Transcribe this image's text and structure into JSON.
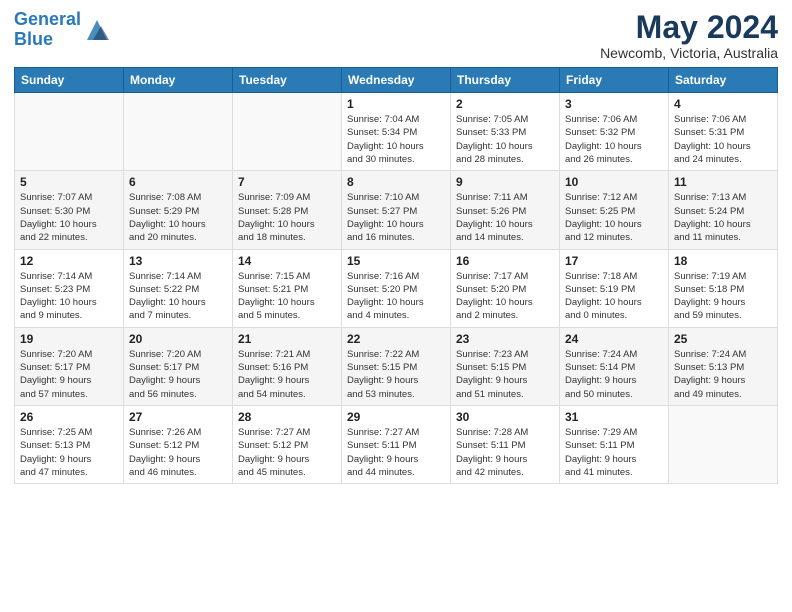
{
  "header": {
    "logo_line1": "General",
    "logo_line2": "Blue",
    "month_year": "May 2024",
    "location": "Newcomb, Victoria, Australia"
  },
  "weekdays": [
    "Sunday",
    "Monday",
    "Tuesday",
    "Wednesday",
    "Thursday",
    "Friday",
    "Saturday"
  ],
  "weeks": [
    [
      {
        "day": "",
        "info": ""
      },
      {
        "day": "",
        "info": ""
      },
      {
        "day": "",
        "info": ""
      },
      {
        "day": "1",
        "info": "Sunrise: 7:04 AM\nSunset: 5:34 PM\nDaylight: 10 hours\nand 30 minutes."
      },
      {
        "day": "2",
        "info": "Sunrise: 7:05 AM\nSunset: 5:33 PM\nDaylight: 10 hours\nand 28 minutes."
      },
      {
        "day": "3",
        "info": "Sunrise: 7:06 AM\nSunset: 5:32 PM\nDaylight: 10 hours\nand 26 minutes."
      },
      {
        "day": "4",
        "info": "Sunrise: 7:06 AM\nSunset: 5:31 PM\nDaylight: 10 hours\nand 24 minutes."
      }
    ],
    [
      {
        "day": "5",
        "info": "Sunrise: 7:07 AM\nSunset: 5:30 PM\nDaylight: 10 hours\nand 22 minutes."
      },
      {
        "day": "6",
        "info": "Sunrise: 7:08 AM\nSunset: 5:29 PM\nDaylight: 10 hours\nand 20 minutes."
      },
      {
        "day": "7",
        "info": "Sunrise: 7:09 AM\nSunset: 5:28 PM\nDaylight: 10 hours\nand 18 minutes."
      },
      {
        "day": "8",
        "info": "Sunrise: 7:10 AM\nSunset: 5:27 PM\nDaylight: 10 hours\nand 16 minutes."
      },
      {
        "day": "9",
        "info": "Sunrise: 7:11 AM\nSunset: 5:26 PM\nDaylight: 10 hours\nand 14 minutes."
      },
      {
        "day": "10",
        "info": "Sunrise: 7:12 AM\nSunset: 5:25 PM\nDaylight: 10 hours\nand 12 minutes."
      },
      {
        "day": "11",
        "info": "Sunrise: 7:13 AM\nSunset: 5:24 PM\nDaylight: 10 hours\nand 11 minutes."
      }
    ],
    [
      {
        "day": "12",
        "info": "Sunrise: 7:14 AM\nSunset: 5:23 PM\nDaylight: 10 hours\nand 9 minutes."
      },
      {
        "day": "13",
        "info": "Sunrise: 7:14 AM\nSunset: 5:22 PM\nDaylight: 10 hours\nand 7 minutes."
      },
      {
        "day": "14",
        "info": "Sunrise: 7:15 AM\nSunset: 5:21 PM\nDaylight: 10 hours\nand 5 minutes."
      },
      {
        "day": "15",
        "info": "Sunrise: 7:16 AM\nSunset: 5:20 PM\nDaylight: 10 hours\nand 4 minutes."
      },
      {
        "day": "16",
        "info": "Sunrise: 7:17 AM\nSunset: 5:20 PM\nDaylight: 10 hours\nand 2 minutes."
      },
      {
        "day": "17",
        "info": "Sunrise: 7:18 AM\nSunset: 5:19 PM\nDaylight: 10 hours\nand 0 minutes."
      },
      {
        "day": "18",
        "info": "Sunrise: 7:19 AM\nSunset: 5:18 PM\nDaylight: 9 hours\nand 59 minutes."
      }
    ],
    [
      {
        "day": "19",
        "info": "Sunrise: 7:20 AM\nSunset: 5:17 PM\nDaylight: 9 hours\nand 57 minutes."
      },
      {
        "day": "20",
        "info": "Sunrise: 7:20 AM\nSunset: 5:17 PM\nDaylight: 9 hours\nand 56 minutes."
      },
      {
        "day": "21",
        "info": "Sunrise: 7:21 AM\nSunset: 5:16 PM\nDaylight: 9 hours\nand 54 minutes."
      },
      {
        "day": "22",
        "info": "Sunrise: 7:22 AM\nSunset: 5:15 PM\nDaylight: 9 hours\nand 53 minutes."
      },
      {
        "day": "23",
        "info": "Sunrise: 7:23 AM\nSunset: 5:15 PM\nDaylight: 9 hours\nand 51 minutes."
      },
      {
        "day": "24",
        "info": "Sunrise: 7:24 AM\nSunset: 5:14 PM\nDaylight: 9 hours\nand 50 minutes."
      },
      {
        "day": "25",
        "info": "Sunrise: 7:24 AM\nSunset: 5:13 PM\nDaylight: 9 hours\nand 49 minutes."
      }
    ],
    [
      {
        "day": "26",
        "info": "Sunrise: 7:25 AM\nSunset: 5:13 PM\nDaylight: 9 hours\nand 47 minutes."
      },
      {
        "day": "27",
        "info": "Sunrise: 7:26 AM\nSunset: 5:12 PM\nDaylight: 9 hours\nand 46 minutes."
      },
      {
        "day": "28",
        "info": "Sunrise: 7:27 AM\nSunset: 5:12 PM\nDaylight: 9 hours\nand 45 minutes."
      },
      {
        "day": "29",
        "info": "Sunrise: 7:27 AM\nSunset: 5:11 PM\nDaylight: 9 hours\nand 44 minutes."
      },
      {
        "day": "30",
        "info": "Sunrise: 7:28 AM\nSunset: 5:11 PM\nDaylight: 9 hours\nand 42 minutes."
      },
      {
        "day": "31",
        "info": "Sunrise: 7:29 AM\nSunset: 5:11 PM\nDaylight: 9 hours\nand 41 minutes."
      },
      {
        "day": "",
        "info": ""
      }
    ]
  ]
}
